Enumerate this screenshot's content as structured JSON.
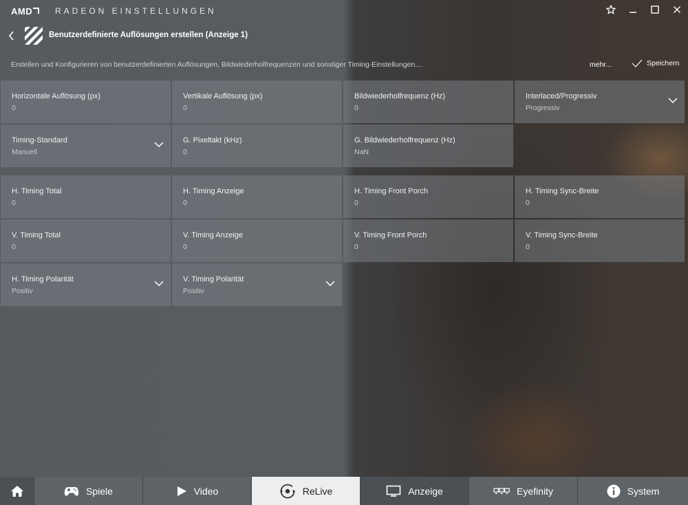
{
  "titlebar": {
    "logo": "AMD",
    "title": "RADEON EINSTELLUNGEN"
  },
  "header": {
    "page_title": "Benutzerdefinierte Auflösungen erstellen (Anzeige 1)",
    "description": "Erstellen und Konfigurieren von benutzerdefinierten Auflösungen, Bildwiederholfrequenzen und sonstiger Timing-Einstellungen....",
    "more_label": "mehr...",
    "save_label": "Speichern"
  },
  "fields": {
    "h_res": {
      "label": "Horizontale Auflösung (px)",
      "value": "0"
    },
    "v_res": {
      "label": "Vertikale Auflösung (px)",
      "value": "0"
    },
    "refresh": {
      "label": "Bildwiederholfrequenz (Hz)",
      "value": "0"
    },
    "interlaced": {
      "label": "Interlaced/Progressiv",
      "value": "Progressiv"
    },
    "timing_std": {
      "label": "Timing-Standard",
      "value": "Manuell"
    },
    "pixelclock": {
      "label": "G. Pixeltakt (kHz)",
      "value": "0"
    },
    "g_refresh": {
      "label": "G. Bildwiederholfrequenz (Hz)",
      "value": "NaN"
    },
    "h_total": {
      "label": "H. Timing Total",
      "value": "0"
    },
    "h_display": {
      "label": "H. Timing Anzeige",
      "value": "0"
    },
    "h_front": {
      "label": "H. Timing Front Porch",
      "value": "0"
    },
    "h_sync": {
      "label": "H. Timing Sync-Breite",
      "value": "0"
    },
    "v_total": {
      "label": "V. Timing Total",
      "value": "0"
    },
    "v_display": {
      "label": "V. Timing Anzeige",
      "value": "0"
    },
    "v_front": {
      "label": "V. Timing Front Porch",
      "value": "0"
    },
    "v_sync": {
      "label": "V. Timing Sync-Breite",
      "value": "0"
    },
    "h_polarity": {
      "label": "H. Timing Polarität",
      "value": "Positiv"
    },
    "v_polarity": {
      "label": "V. Timing Polarität",
      "value": "Positiv"
    }
  },
  "nav": {
    "home_icon": "home-icon",
    "items": [
      {
        "label": "Spiele",
        "icon": "gamepad-icon"
      },
      {
        "label": "Video",
        "icon": "play-icon"
      },
      {
        "label": "ReLive",
        "icon": "relive-icon"
      },
      {
        "label": "Anzeige",
        "icon": "monitor-icon"
      },
      {
        "label": "Eyefinity",
        "icon": "eyefinity-icon"
      },
      {
        "label": "System",
        "icon": "info-icon"
      }
    ],
    "active": "ReLive"
  },
  "colors": {
    "tile_bg": "#7e848a",
    "nav_bg": "#5e6367",
    "nav_active_bg": "#eceeef"
  }
}
